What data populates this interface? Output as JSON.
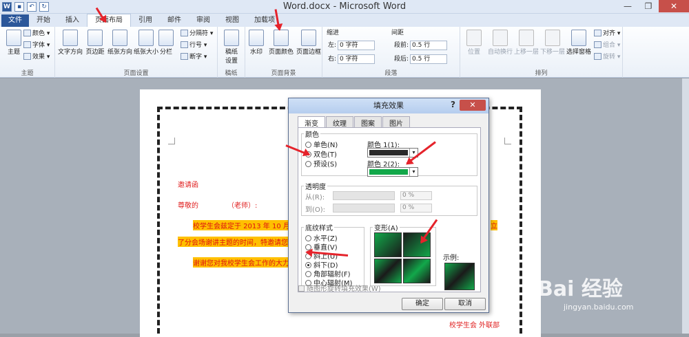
{
  "window": {
    "title": "Word.docx - Microsoft Word",
    "minimize": "—",
    "restore": "❐",
    "close": "✕"
  },
  "qat": {
    "word_icon": "W",
    "save": "▪",
    "undo": "↶",
    "redo": "↻"
  },
  "tabs": [
    "文件",
    "开始",
    "插入",
    "页面布局",
    "引用",
    "邮件",
    "审阅",
    "视图",
    "加载项"
  ],
  "ribbon": {
    "theme": {
      "label": "主题",
      "btn": "主题",
      "colors": "颜色 ▾",
      "fonts": "字体 ▾",
      "effects": "效果 ▾"
    },
    "page_setup": {
      "label": "页面设置",
      "text_direction": "文字方向",
      "margins": "页边距",
      "orientation": "纸张方向",
      "size": "纸张大小",
      "columns": "分栏",
      "breaks": "分隔符 ▾",
      "line_numbers": "行号 ▾",
      "hyphenation": "断字 ▾"
    },
    "draft": {
      "label": "稿纸",
      "btn1": "稿纸",
      "btn2": "设置"
    },
    "background": {
      "label": "页面背景",
      "watermark": "水印",
      "page_color": "页面颜色",
      "page_border": "页面边框"
    },
    "paragraph": {
      "label": "段落",
      "indent": "缩进",
      "spacing": "间距",
      "left_label": "左:",
      "left_val": "0 字符",
      "right_label": "右:",
      "right_val": "0 字符",
      "before_label": "段前:",
      "before_val": "0.5 行",
      "after_label": "段后:",
      "after_val": "0.5 行"
    },
    "arrange": {
      "label": "排列",
      "position": "位置",
      "wrap": "自动换行",
      "forward": "上移一层",
      "backward": "下移一层",
      "selection_pane": "选择窗格",
      "align": "对齐 ▾",
      "group": "组合 ▾",
      "rotate": "旋转 ▾"
    }
  },
  "document": {
    "line1": "邀请函",
    "line2a": "尊敬的",
    "line2b": "（老师）:",
    "line3": "校学生会兹定于 2013 年 10 月",
    "line3_tail": "立",
    "line4": "了分会场谢讲主题的时间，特邀请您",
    "line5": "谢谢您对我校学生会工作的大力",
    "signature": "校学生会  外联部"
  },
  "dialog": {
    "title": "填充效果",
    "help": "?",
    "close": "✕",
    "tabs": [
      "渐变",
      "纹理",
      "图案",
      "图片"
    ],
    "colors_legend": "颜色",
    "radio_one": "单色(N)",
    "radio_two": "双色(T)",
    "radio_preset": "预设(S)",
    "color1_label": "颜色 1(1):",
    "color2_label": "颜色 2(2):",
    "color1_hex": "#2a2a2a",
    "color2_hex": "#12a84a",
    "transparency_legend": "透明度",
    "from_label": "从(R):",
    "to_label": "到(O):",
    "from_val": "0 %",
    "to_val": "0 %",
    "shading_legend": "底纹样式",
    "shading": [
      "水平(Z)",
      "垂直(V)",
      "斜上(U)",
      "斜下(D)",
      "角部辐射(F)",
      "中心辐射(M)"
    ],
    "variants_legend": "变形(A)",
    "sample_label": "示例:",
    "rotate_check": "随图形旋转填充效果(W)",
    "ok": "确定",
    "cancel": "取消"
  },
  "watermark": {
    "brand": "Bai 经验",
    "url": "jingyan.baidu.com"
  }
}
